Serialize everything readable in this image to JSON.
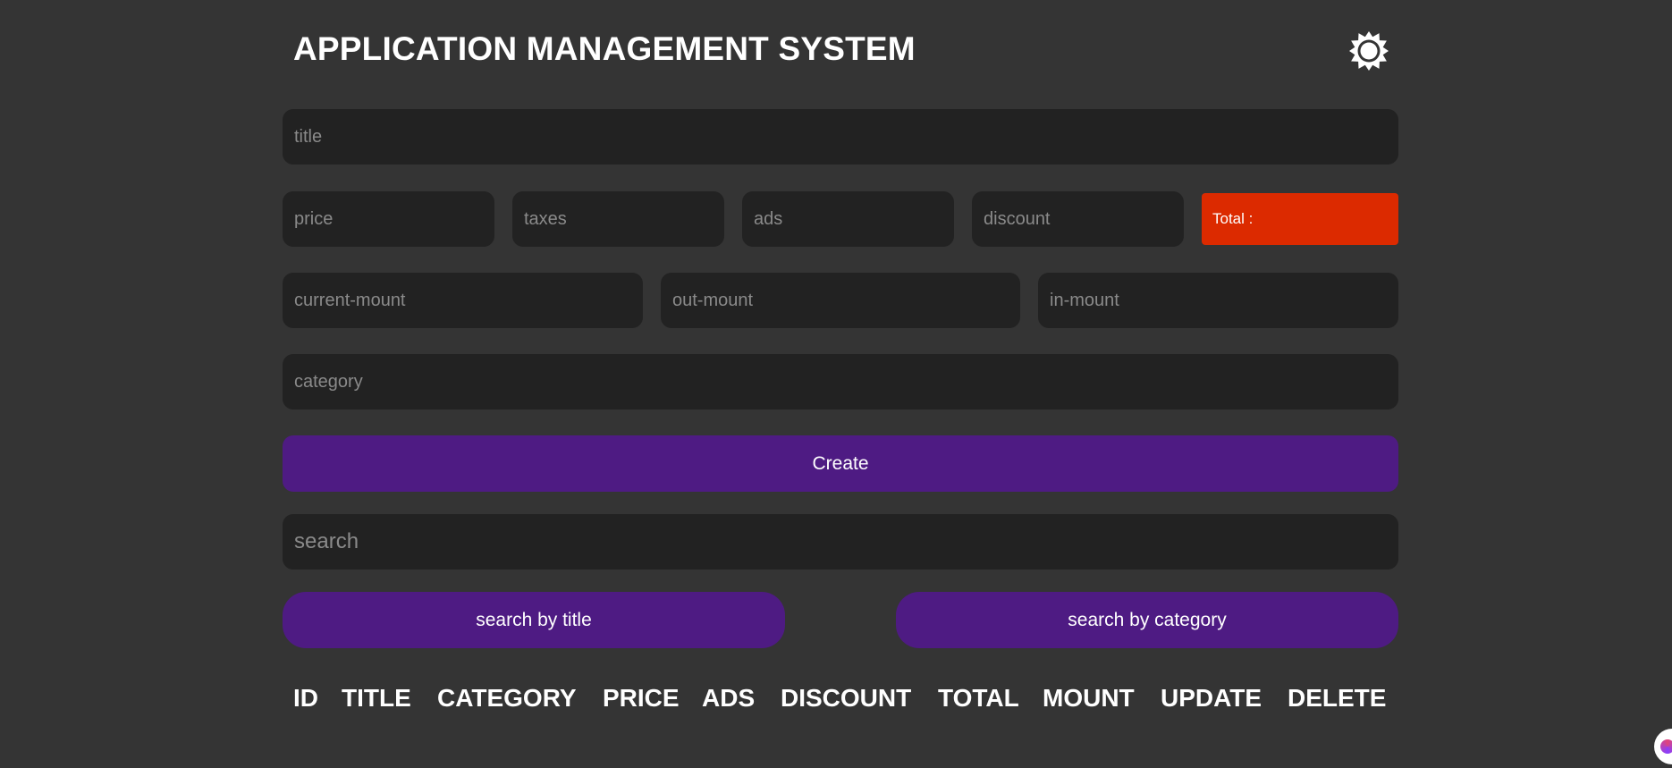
{
  "header": {
    "title": "APPLICATION MANAGEMENT SYSTEM",
    "theme_icon": "sun-icon"
  },
  "form": {
    "title_placeholder": "title",
    "price_placeholder": "price",
    "taxes_placeholder": "taxes",
    "ads_placeholder": "ads",
    "discount_placeholder": "discount",
    "total_label": "Total :",
    "current_mount_placeholder": "current-mount",
    "out_mount_placeholder": "out-mount",
    "in_mount_placeholder": "in-mount",
    "category_placeholder": "category",
    "create_label": "Create"
  },
  "search": {
    "placeholder": "search",
    "by_title_label": "search by title",
    "by_category_label": "search by category"
  },
  "table": {
    "headers": [
      "ID",
      "TITLE",
      "CATEGORY",
      "PRICE",
      "ADS",
      "DISCOUNT",
      "TOTAL",
      "MOUNT",
      "UPDATE",
      "DELETE"
    ]
  },
  "colors": {
    "background": "#343434",
    "field": "#222222",
    "accent_button": "#4e1b83",
    "total_box": "#dc2a00",
    "text": "#ffffff",
    "placeholder": "#8a8a8a"
  }
}
